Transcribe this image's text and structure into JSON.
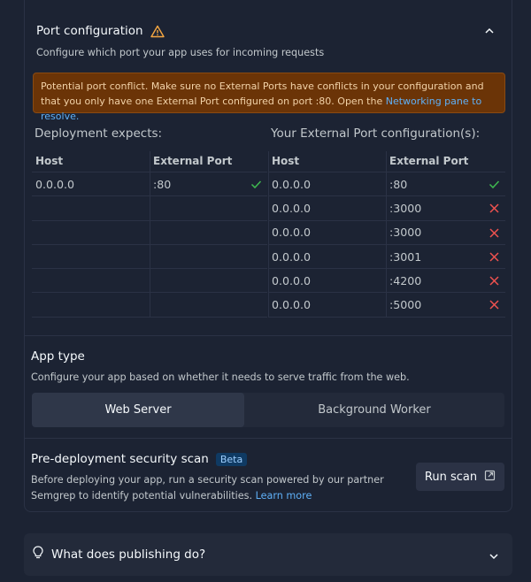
{
  "port_section": {
    "title": "Port configuration",
    "subtitle": "Configure which port your app uses for incoming requests",
    "alert": {
      "text": "Potential port conflict. Make sure no External Ports have conflicts in your configuration and that you only have one External Port configured on port :80. Open the ",
      "link": "Networking pane to resolve."
    },
    "deployment": {
      "heading": "Deployment expects:",
      "col_host": "Host",
      "col_port": "External Port",
      "rows": [
        {
          "host": "0.0.0.0",
          "port": ":80",
          "status": "ok"
        }
      ]
    },
    "external": {
      "heading": "Your External Port configuration(s):",
      "col_host": "Host",
      "col_port": "External Port",
      "rows": [
        {
          "host": "0.0.0.0",
          "port": ":80",
          "status": "ok"
        },
        {
          "host": "0.0.0.0",
          "port": ":3000",
          "status": "error"
        },
        {
          "host": "0.0.0.0",
          "port": ":3000",
          "status": "error"
        },
        {
          "host": "0.0.0.0",
          "port": ":3001",
          "status": "error"
        },
        {
          "host": "0.0.0.0",
          "port": ":4200",
          "status": "error"
        },
        {
          "host": "0.0.0.0",
          "port": ":5000",
          "status": "error"
        }
      ]
    }
  },
  "app_type": {
    "title": "App type",
    "subtitle": "Configure your app based on whether it needs to serve traffic from the web.",
    "options": [
      "Web Server",
      "Background Worker"
    ],
    "selected": "Web Server"
  },
  "security_scan": {
    "title": "Pre-deployment security scan",
    "badge": "Beta",
    "description": "Before deploying your app, run a security scan powered by our partner Semgrep to identify potential vulnerabilities. ",
    "learn_more": "Learn more",
    "button": "Run scan"
  },
  "faq": {
    "question": "What does publishing do?"
  },
  "colors": {
    "ok": "#3fb950",
    "error": "#f0524f",
    "warning": "#f5a742",
    "link": "#5fb0f7"
  }
}
